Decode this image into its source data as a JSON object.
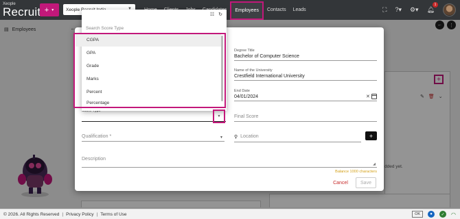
{
  "header": {
    "logo_top": "Xeople",
    "logo_main": "Recruit",
    "quick_add": "+",
    "company": "Xeople Recruit India",
    "nav": [
      "Home",
      "Clients",
      "Jobs",
      "Candidates",
      "Employees",
      "Contacts",
      "Leads"
    ],
    "active_nav": "Employees",
    "notification_count": "1"
  },
  "page": {
    "title": "Employees"
  },
  "background": {
    "no_items_text": "dded yet."
  },
  "dropdown": {
    "search_placeholder": "Search Score Type",
    "options": [
      "CGPA",
      "GPA",
      "Grade",
      "Marks",
      "Percent",
      "Percentage"
    ],
    "highlighted_option": "CGPA"
  },
  "form": {
    "degree_title_label": "Degree Title",
    "degree_title_value": "Bachelor of Computer Science",
    "university_label": "Name of the University",
    "university_value": "Crestfield International University",
    "end_date_label": "End Date",
    "end_date_value": "04/01/2024",
    "score_type_label": "Score Type",
    "final_score_placeholder": "Final Score",
    "qualification_placeholder": "Qualification *",
    "location_placeholder": "Location",
    "description_placeholder": "Description",
    "balance_text": "Balance 1000 characters",
    "cancel_label": "Cancel",
    "save_label": "Save"
  },
  "footer": {
    "copyright": "© 2026. All Rights Reserved",
    "privacy": "Privacy Policy",
    "terms": "Terms of Use",
    "status": "OK"
  },
  "colors": {
    "accent": "#c2187a",
    "topbar": "#333639",
    "cancel": "#c62828"
  }
}
